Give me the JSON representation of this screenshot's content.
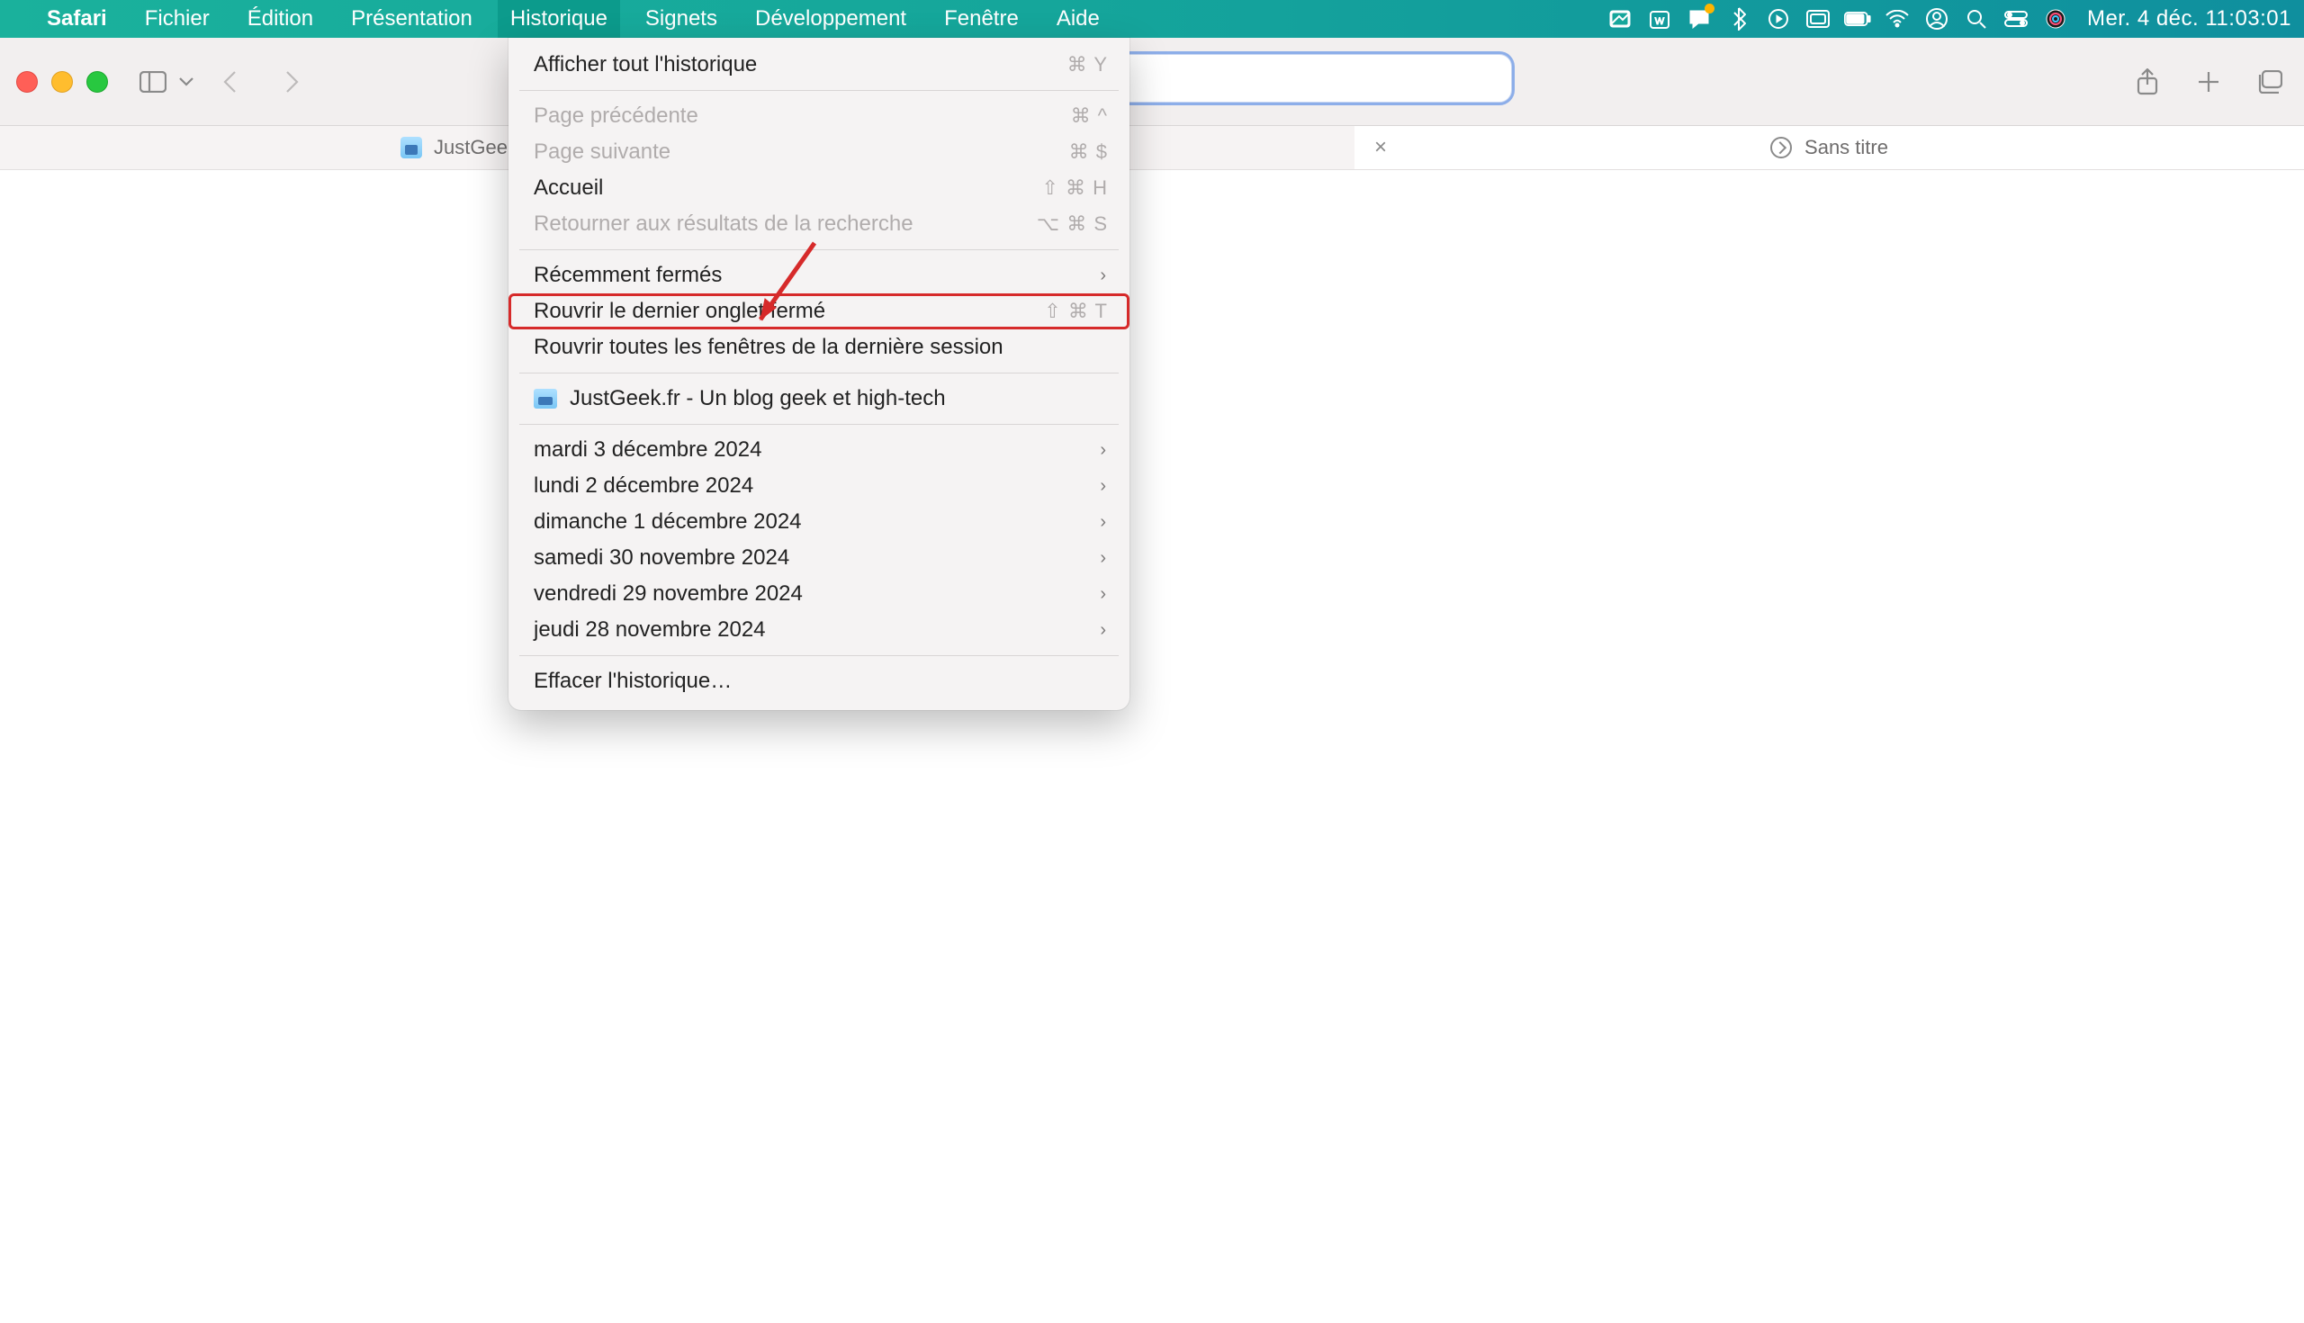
{
  "menubar": {
    "app": "Safari",
    "items": [
      "Fichier",
      "Édition",
      "Présentation",
      "Historique",
      "Signets",
      "Développement",
      "Fenêtre",
      "Aide"
    ],
    "active_index": 3,
    "clock": "Mer. 4 déc.  11:03:01"
  },
  "tabs": {
    "tab1_title": "JustGeek.",
    "tab2_title": "Sans titre"
  },
  "dropdown": {
    "show_all_history": {
      "label": "Afficher tout l'historique",
      "shortcut": "⌘ Y"
    },
    "back": {
      "label": "Page précédente",
      "shortcut": "⌘ ^"
    },
    "forward": {
      "label": "Page suivante",
      "shortcut": "⌘ $"
    },
    "home": {
      "label": "Accueil",
      "shortcut": "⇧ ⌘ H"
    },
    "search_results": {
      "label": "Retourner aux résultats de la recherche",
      "shortcut": "⌥ ⌘ S"
    },
    "recently_closed": {
      "label": "Récemment fermés"
    },
    "reopen_last_tab": {
      "label": "Rouvrir le dernier onglet fermé",
      "shortcut": "⇧ ⌘ T"
    },
    "reopen_all_windows": {
      "label": "Rouvrir toutes les fenêtres de la dernière session"
    },
    "recent_page": {
      "label": "JustGeek.fr - Un blog geek et high-tech"
    },
    "days": [
      "mardi 3 décembre 2024",
      "lundi 2 décembre 2024",
      "dimanche 1 décembre 2024",
      "samedi 30 novembre 2024",
      "vendredi 29 novembre 2024",
      "jeudi 28 novembre 2024"
    ],
    "clear": {
      "label": "Effacer l'historique…"
    }
  }
}
